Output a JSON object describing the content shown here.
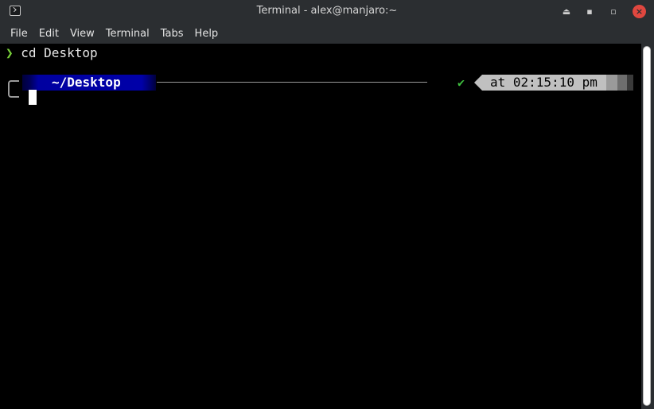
{
  "window": {
    "title": "Terminal - alex@manjaro:~",
    "icons": {
      "app": "terminal-icon",
      "shade": "shade-icon",
      "minimize": "minimize-icon",
      "maximize": "maximize-icon",
      "close": "close-icon"
    }
  },
  "menu": {
    "file": "File",
    "edit": "Edit",
    "view": "View",
    "terminal": "Terminal",
    "tabs": "Tabs",
    "help": "Help"
  },
  "terminal": {
    "prompt_symbol": "❯",
    "command": " cd Desktop",
    "path": "~/Desktop",
    "status_symbol": "✔",
    "time": "at 02:15:10 pm"
  },
  "colors": {
    "titlebar": "#2b2e31",
    "path_segment": "#0000a8",
    "time_segment": "#c0c0c0",
    "close_button": "#e0473f",
    "prompt_green": "#7ad33a"
  }
}
